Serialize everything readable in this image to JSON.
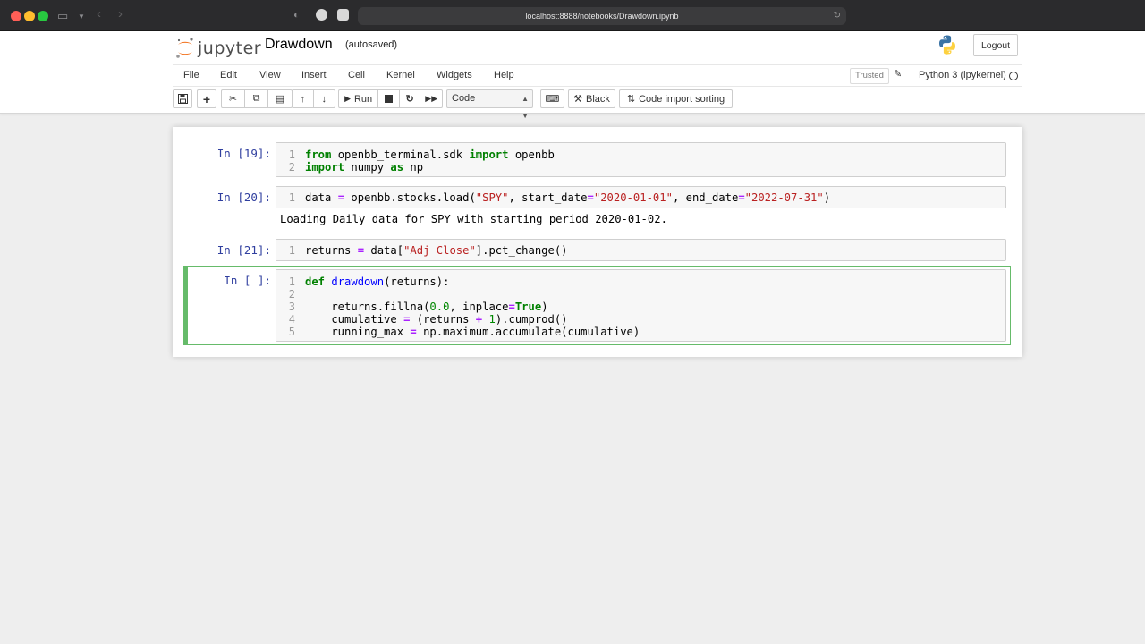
{
  "browser": {
    "url": "localhost:8888/notebooks/Drawdown.ipynb"
  },
  "header": {
    "logo_text": "jupyter",
    "notebook_title": "Drawdown",
    "autosave_status": "(autosaved)",
    "logout_label": "Logout"
  },
  "menu": {
    "items": [
      "File",
      "Edit",
      "View",
      "Insert",
      "Cell",
      "Kernel",
      "Widgets",
      "Help"
    ],
    "trusted_label": "Trusted",
    "kernel_name": "Python 3 (ipykernel)"
  },
  "toolbar": {
    "run_label": "Run",
    "cell_type": "Code",
    "black_label": "Black",
    "import_sort_label": "Code import sorting"
  },
  "cells": [
    {
      "prompt": "In [19]:",
      "line_numbers": [
        "1",
        "2"
      ]
    },
    {
      "prompt": "In [20]:",
      "line_numbers": [
        "1"
      ],
      "output": "Loading Daily data for SPY with starting period 2020-01-02."
    },
    {
      "prompt": "In [21]:",
      "line_numbers": [
        "1"
      ]
    },
    {
      "prompt": "In [ ]:",
      "line_numbers": [
        "1",
        "2",
        "3",
        "4",
        "5"
      ]
    }
  ],
  "colors": {
    "prompt": "#303f9f",
    "keyword": "#008000",
    "string": "#ba2121",
    "operator": "#aa22ff",
    "selected_border": "#66bb6a"
  }
}
